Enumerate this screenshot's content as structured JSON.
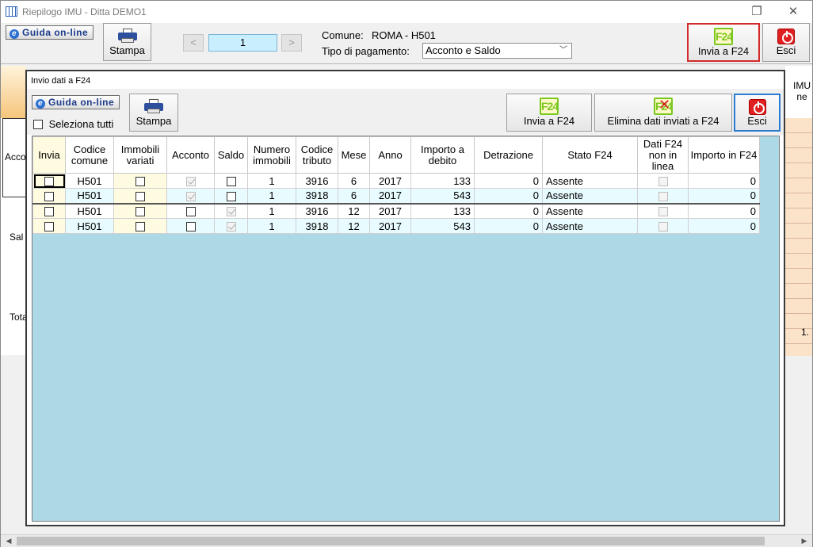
{
  "window": {
    "title": "Riepilogo IMU - Ditta DEMO1"
  },
  "toolbar": {
    "guida_label": "Guida on-line",
    "stampa_label": "Stampa",
    "prev_label": "<",
    "next_label": ">",
    "page_number": "1",
    "comune_label": "Comune:",
    "comune_value": "ROMA - H501",
    "tipo_label": "Tipo di pagamento:",
    "tipo_value": "Acconto e Saldo",
    "invia_label": "Invia a F24",
    "esci_label": "Esci"
  },
  "background": {
    "right_header": "IMU ne",
    "left_rows": [
      "Acco",
      "Sal",
      "Tota"
    ],
    "right_value": "1."
  },
  "dialog": {
    "title": "Invio dati a F24",
    "guida_label": "Guida on-line",
    "seleziona_label": "Seleziona tutti",
    "stampa_label": "Stampa",
    "invia_label": "Invia a F24",
    "elimina_label": "Elimina dati inviati a F24",
    "esci_label": "Esci"
  },
  "grid": {
    "columns": [
      "Invia",
      "Codice comune",
      "Immobili variati",
      "Acconto",
      "Saldo",
      "Numero immobili",
      "Codice tributo",
      "Mese",
      "Anno",
      "Importo a debito",
      "Detrazione",
      "Stato F24",
      "Dati F24 non in linea",
      "Importo in F24"
    ],
    "rows": [
      {
        "codice_comune": "H501",
        "numero_immobili": "1",
        "codice_tributo": "3916",
        "mese": "6",
        "anno": "2017",
        "importo_debito": "133",
        "detrazione": "0",
        "stato": "Assente",
        "importo_f24": "0",
        "acconto": true,
        "saldo": false
      },
      {
        "codice_comune": "H501",
        "numero_immobili": "1",
        "codice_tributo": "3918",
        "mese": "6",
        "anno": "2017",
        "importo_debito": "543",
        "detrazione": "0",
        "stato": "Assente",
        "importo_f24": "0",
        "acconto": true,
        "saldo": false
      },
      {
        "codice_comune": "H501",
        "numero_immobili": "1",
        "codice_tributo": "3916",
        "mese": "12",
        "anno": "2017",
        "importo_debito": "133",
        "detrazione": "0",
        "stato": "Assente",
        "importo_f24": "0",
        "acconto": false,
        "saldo": true
      },
      {
        "codice_comune": "H501",
        "numero_immobili": "1",
        "codice_tributo": "3918",
        "mese": "12",
        "anno": "2017",
        "importo_debito": "543",
        "detrazione": "0",
        "stato": "Assente",
        "importo_f24": "0",
        "acconto": false,
        "saldo": true
      }
    ]
  },
  "colors": {
    "grid_background": "#add8e6",
    "highlight_border": "#d42a2a",
    "accent_blue": "#2b62b8",
    "f24_green": "#7bc81f"
  }
}
